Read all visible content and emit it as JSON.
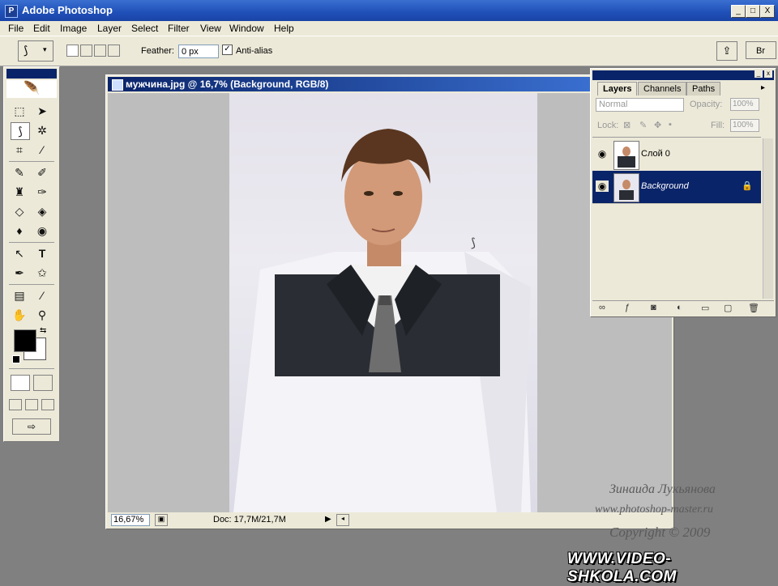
{
  "app": {
    "title": "Adobe Photoshop"
  },
  "window_buttons": {
    "minimize": "_",
    "maximize": "□",
    "close": "X"
  },
  "menu": [
    "File",
    "Edit",
    "Image",
    "Layer",
    "Select",
    "Filter",
    "View",
    "Window",
    "Help"
  ],
  "options": {
    "feather_label": "Feather:",
    "feather_value": "0 px",
    "antialias_label": "Anti-alias",
    "antialias_checked": true,
    "right_label": "Br"
  },
  "document": {
    "title": "мужчина.jpg @ 16,7% (Background, RGB/8)",
    "zoom": "16,67%",
    "info": "Doc: 17,7M/21,7M"
  },
  "layers_panel": {
    "tabs": [
      "Layers",
      "Channels",
      "Paths"
    ],
    "blend_mode": "Normal",
    "opacity_label": "Opacity:",
    "opacity_value": "100%",
    "lock_label": "Lock:",
    "fill_label": "Fill:",
    "fill_value": "100%",
    "layers": [
      {
        "name": "Слой 0",
        "selected": false
      },
      {
        "name": "Background",
        "selected": true,
        "locked": true
      }
    ]
  },
  "watermark": {
    "author": "Зинаида Лукьянова",
    "site": "www.photoshop-master.ru",
    "copyright": "Copyright © 2009",
    "brand": "WWW.VIDEO-SHKOLA.COM"
  },
  "colors": {
    "titlebar": "#1f4fb8",
    "selection": "#0a246a",
    "foreground": "#000000",
    "background_swatch": "#ffffff"
  }
}
